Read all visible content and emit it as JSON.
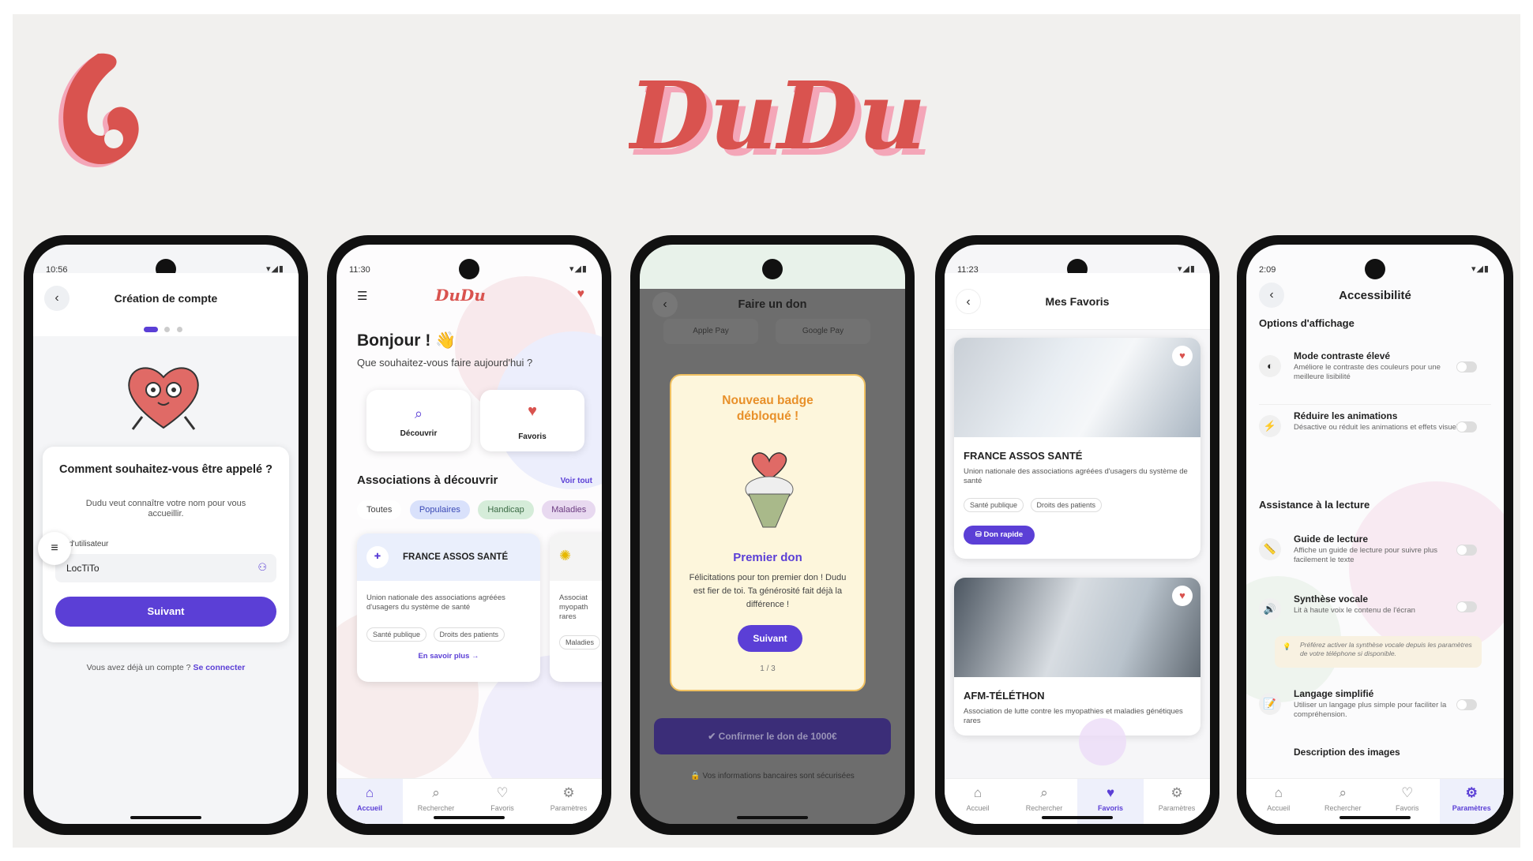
{
  "brand": {
    "name": "DuDu",
    "color": "#d9534f"
  },
  "accent": "#5b3fd6",
  "screen1": {
    "time": "10:56",
    "title": "Création de compte",
    "question": "Comment souhaitez-vous être appelé ?",
    "subtitle": "Dudu veut connaître votre nom pour vous accueillir.",
    "field_label": "m d'utilisateur",
    "field_value": "LocTiTo",
    "next": "Suivant",
    "have_account": "Vous avez déjà un compte ?",
    "login": "Se connecter"
  },
  "screen2": {
    "time": "11:30",
    "greeting": "Bonjour ! 👋",
    "question": "Que souhaitez-vous faire aujourd'hui ?",
    "action1": "Découvrir",
    "action2": "Favoris",
    "section": "Associations à découvrir",
    "see_all": "Voir tout",
    "chips": [
      "Toutes",
      "Populaires",
      "Handicap",
      "Maladies"
    ],
    "assoc_name": "FRANCE ASSOS SANTÉ",
    "assoc_desc": "Union nationale des associations agréées d'usagers du système de santé",
    "tags": [
      "Santé publique",
      "Droits des patients"
    ],
    "more": "En savoir plus →",
    "assoc2_desc": "Associat myopath rares",
    "assoc2_tag": "Maladies"
  },
  "screen3": {
    "title": "Faire un don",
    "pay1": "Apple Pay",
    "pay2": "Google Pay",
    "badge_title": "Nouveau badge débloqué !",
    "badge_name": "Premier don",
    "badge_text": "Félicitations pour ton premier don ! Dudu est fier de toi. Ta générosité fait déjà la différence !",
    "next": "Suivant",
    "pager": "1 / 3",
    "confirm": "Confirmer le don de 1000€",
    "secure": "🔒 Vos informations bancaires sont sécurisées"
  },
  "screen4": {
    "time": "11:23",
    "title": "Mes Favoris",
    "fav1_name": "FRANCE ASSOS SANTÉ",
    "fav1_desc": "Union nationale des associations agréées d'usagers du système de santé",
    "fav1_tags": [
      "Santé publique",
      "Droits des patients"
    ],
    "quick_donate": "Don rapide",
    "fav2_name": "AFM-TÉLÉTHON",
    "fav2_desc": "Association de lutte contre les myopathies et maladies génétiques rares"
  },
  "screen5": {
    "time": "2:09",
    "title": "Accessibilité",
    "section1": "Options d'affichage",
    "opt1_title": "Mode contraste élevé",
    "opt1_desc": "Améliore le contraste des couleurs pour une meilleure lisibilité",
    "opt2_title": "Réduire les animations",
    "opt2_desc": "Désactive ou réduit les animations et effets visuels",
    "section2": "Assistance à la lecture",
    "opt3_title": "Guide de lecture",
    "opt3_desc": "Affiche un guide de lecture pour suivre plus facilement le texte",
    "opt4_title": "Synthèse vocale",
    "opt4_desc": "Lit à haute voix le contenu de l'écran",
    "tip": "Préférez activer la synthèse vocale depuis les paramètres de votre téléphone si disponible.",
    "opt5_title": "Langage simplifié",
    "opt5_desc": "Utiliser un langage plus simple pour faciliter la compréhension.",
    "opt6_title": "Description des images"
  },
  "nav": [
    "Accueil",
    "Rechercher",
    "Favoris",
    "Paramètres"
  ],
  "icons": {
    "home": "home-icon",
    "search": "search-icon",
    "heart": "heart-icon",
    "gear": "gear-icon"
  }
}
